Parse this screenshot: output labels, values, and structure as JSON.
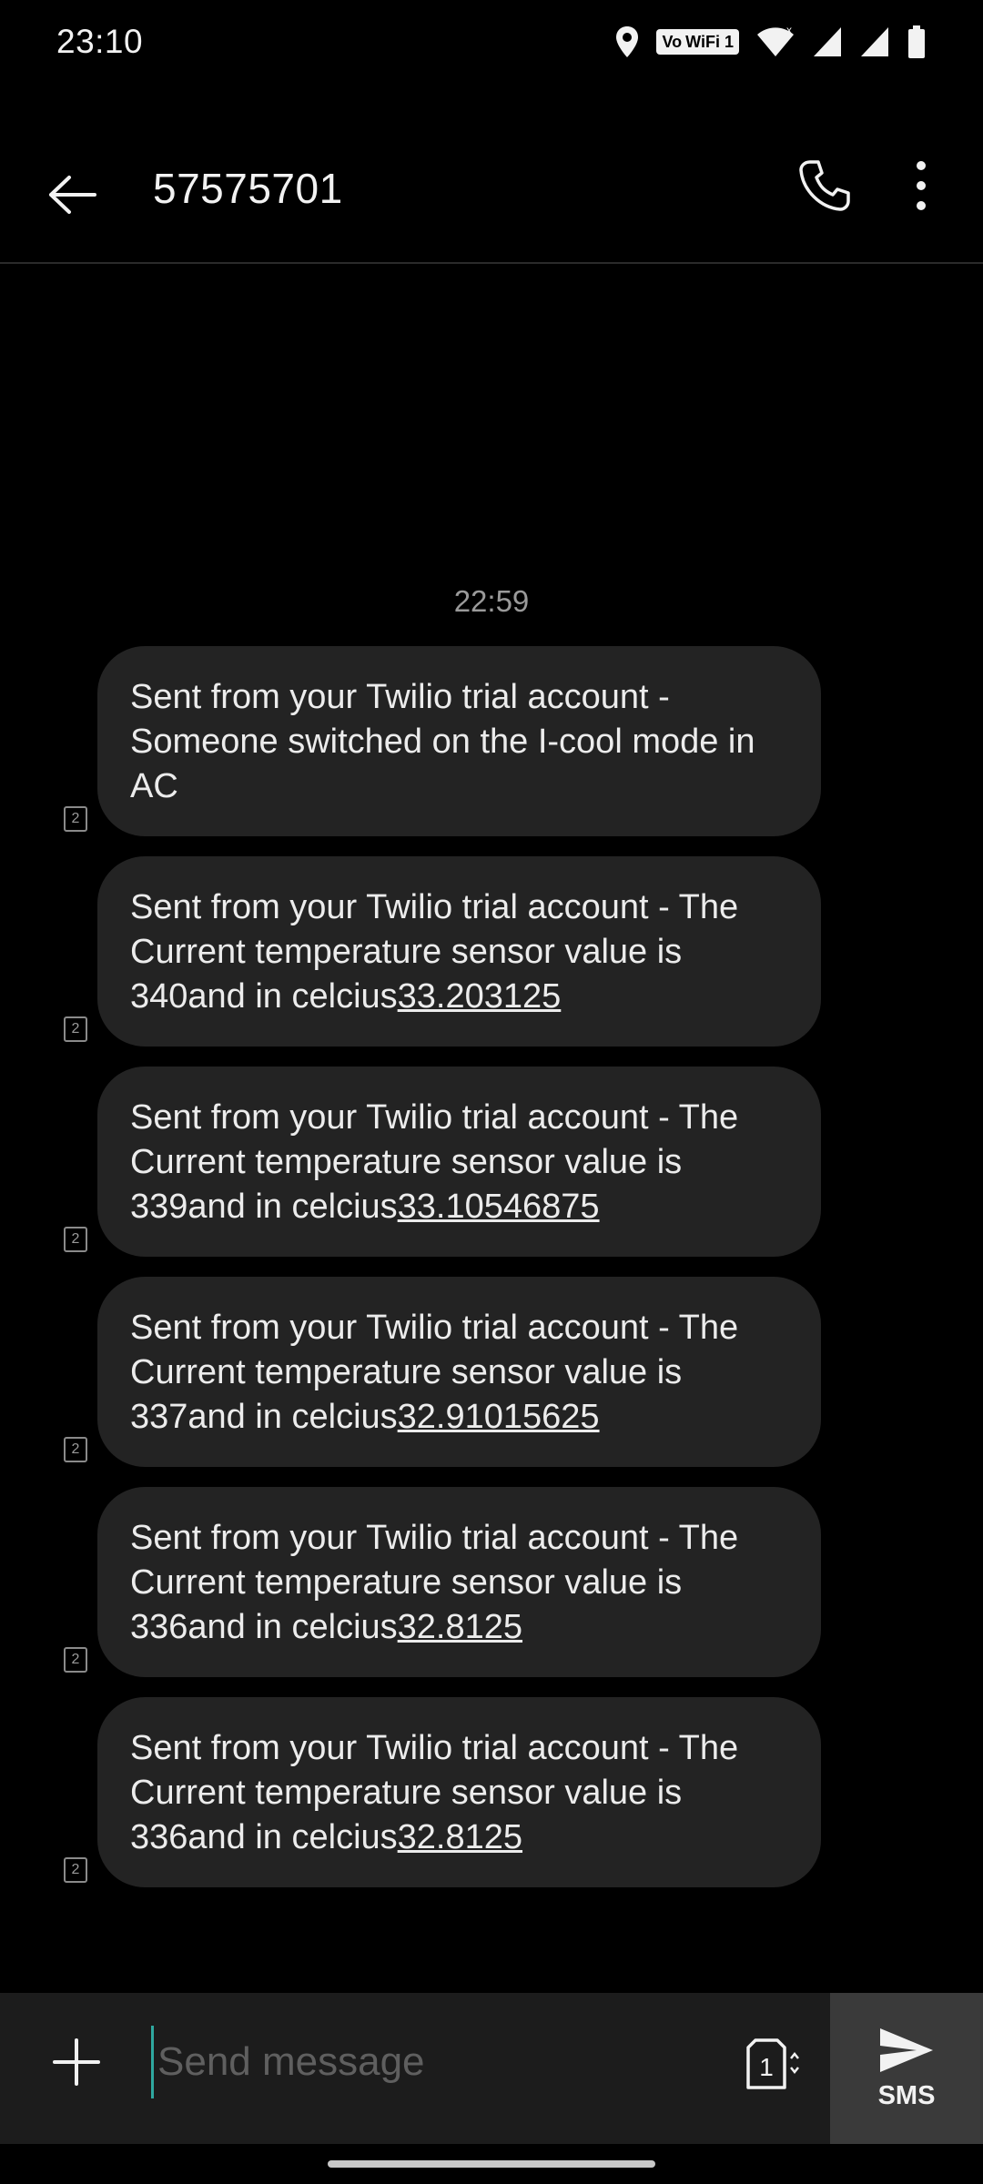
{
  "status_bar": {
    "time": "23:10",
    "wifi_badge_prefix": "Vo",
    "wifi_badge_label": "WiFi 1",
    "icons": [
      "location-icon",
      "vowifi-badge",
      "wifi-icon",
      "signal-icon",
      "signal-icon",
      "battery-icon"
    ]
  },
  "header": {
    "contact": "57575701",
    "back_icon": "arrow-back-icon",
    "call_icon": "phone-icon",
    "more_icon": "more-vert-icon"
  },
  "conversation": {
    "timestamp": "22:59",
    "sim_label": "2",
    "messages": [
      {
        "text": "Sent from your Twilio trial account - Someone switched on the I-cool mode in AC",
        "link": ""
      },
      {
        "text": "Sent from your Twilio trial account - The Current temperature sensor value is 340and in celcius",
        "link": "33.203125"
      },
      {
        "text": "Sent from your Twilio trial account - The Current temperature sensor value is 339and in celcius",
        "link": "33.10546875"
      },
      {
        "text": "Sent from your Twilio trial account - The Current temperature sensor value is 337and in celcius",
        "link": "32.91015625"
      },
      {
        "text": "Sent from your Twilio trial account - The Current temperature sensor value is 336and in celcius",
        "link": "32.8125"
      },
      {
        "text": "Sent from your Twilio trial account - The Current temperature sensor value is 336and in celcius",
        "link": "32.8125"
      }
    ]
  },
  "compose": {
    "placeholder": "Send message",
    "value": "",
    "sim_selected": "1",
    "send_label": "SMS"
  },
  "colors": {
    "background": "#000000",
    "bubble": "#232323",
    "compose_bar": "#1c1c1c",
    "send_button": "#3a3a3a",
    "cursor": "#2fa8a0"
  }
}
